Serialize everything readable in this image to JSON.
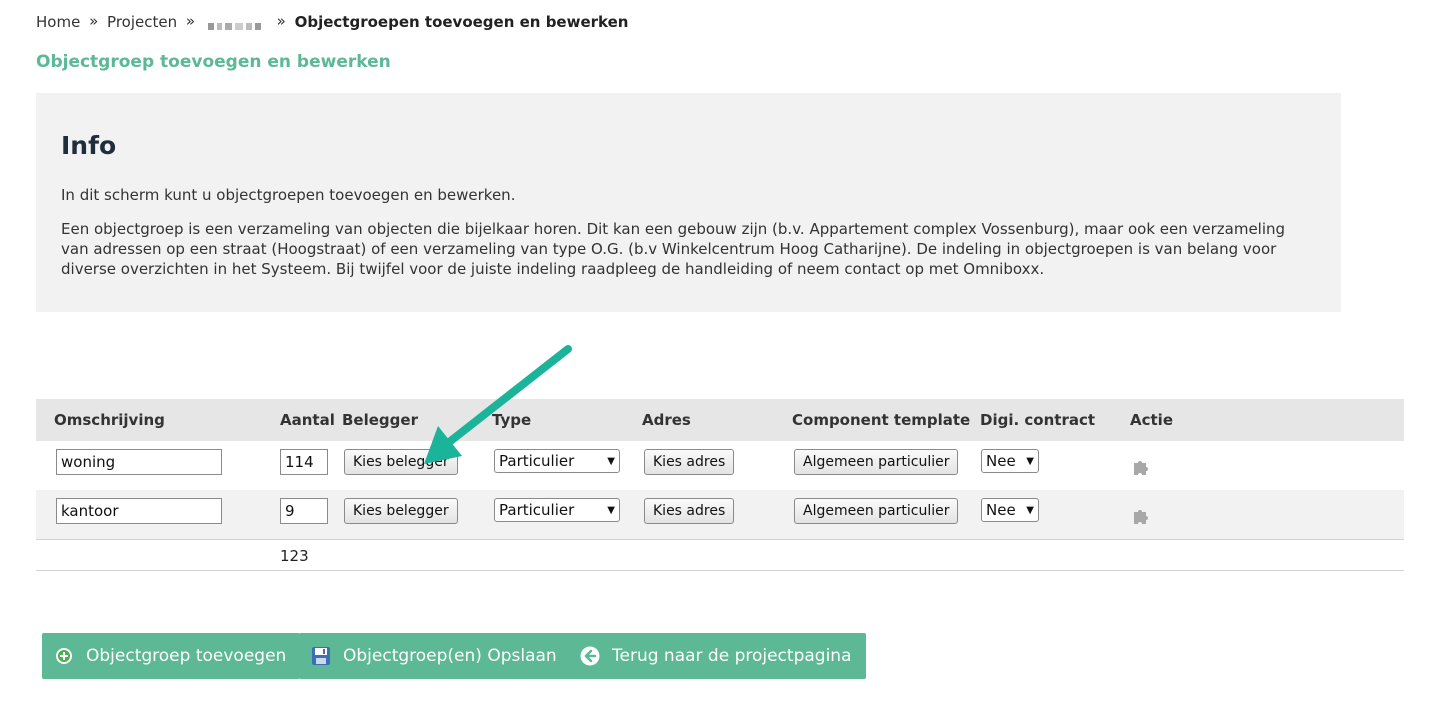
{
  "breadcrumb": {
    "home": "Home",
    "projects": "Projecten",
    "separator": "»",
    "current": "Objectgroepen toevoegen en bewerken"
  },
  "page_title": "Objectgroep toevoegen en bewerken",
  "info": {
    "heading": "Info",
    "paragraph1": "In dit scherm kunt u objectgroepen toevoegen en bewerken.",
    "paragraph2": "Een objectgroep is een verzameling van objecten die bijelkaar horen. Dit kan een gebouw zijn (b.v. Appartement complex Vossenburg), maar ook een verzameling van adressen op een straat (Hoogstraat) of een verzameling van type O.G. (b.v Winkelcentrum Hoog Catharijne). De indeling in objectgroepen is van belang voor diverse overzichten in het Systeem. Bij twijfel voor de juiste indeling raadpleeg de handleiding of neem contact op met Omniboxx."
  },
  "table": {
    "headers": {
      "description": "Omschrijving",
      "count": "Aantal",
      "investor": "Belegger",
      "type": "Type",
      "address": "Adres",
      "component_template": "Component template",
      "digi_contract": "Digi. contract",
      "action": "Actie"
    },
    "rows": [
      {
        "description": "woning",
        "count": "114",
        "investor_button": "Kies belegger",
        "type": "Particulier",
        "address_button": "Kies adres",
        "component_template_button": "Algemeen particulier",
        "digi_contract": "Nee",
        "action_icon": "puzzle-icon"
      },
      {
        "description": "kantoor",
        "count": "9",
        "investor_button": "Kies belegger",
        "type": "Particulier",
        "address_button": "Kies adres",
        "component_template_button": "Algemeen particulier",
        "digi_contract": "Nee",
        "action_icon": "puzzle-icon"
      }
    ],
    "total_count": "123"
  },
  "actions": {
    "add_label": "Objectgroep toevoegen",
    "add_icon": "plus-circle-icon",
    "save_label": "Objectgroep(en) Opslaan",
    "save_icon": "floppy-disk-icon",
    "back_label": "Terug naar de projectpagina",
    "back_icon": "arrow-left-circle-icon"
  },
  "colors": {
    "accent_green": "#5cb895",
    "annotation_arrow": "#1bb39a",
    "info_background": "#f2f2f2",
    "table_header_background": "#e6e6e6"
  }
}
